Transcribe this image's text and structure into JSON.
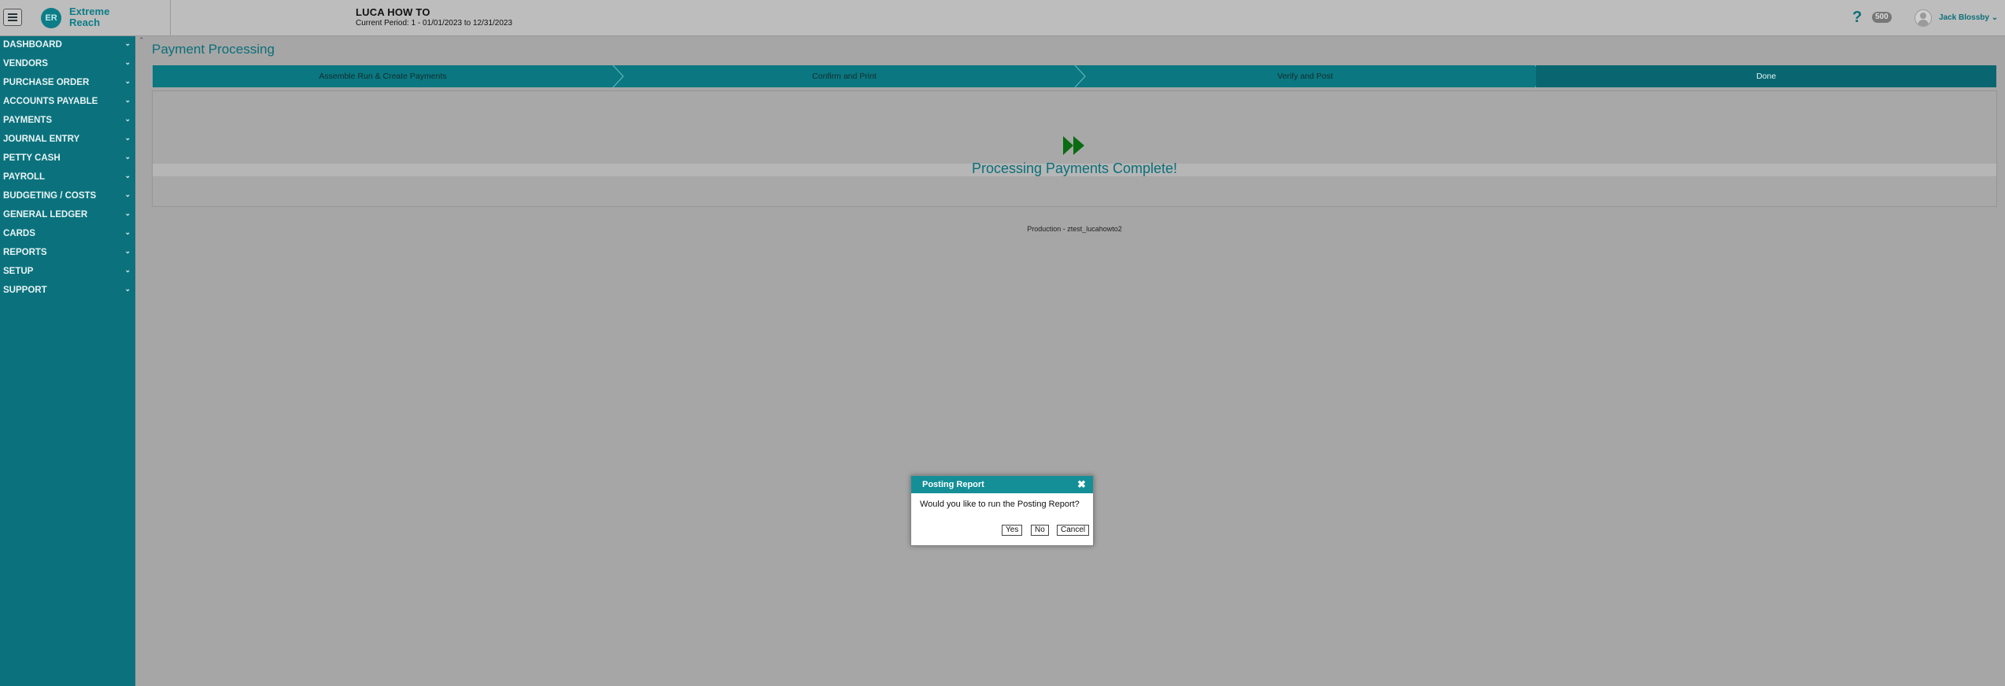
{
  "header": {
    "logo_initials": "ER",
    "logo_line1": "Extreme",
    "logo_line2": "Reach",
    "company": "LUCA HOW TO",
    "period": "Current Period: 1 - 01/01/2023 to 12/31/2023",
    "help_symbol": "?",
    "count_badge": "500",
    "user_name": "Jack Blossby",
    "user_caret": "⌄"
  },
  "sidebar": {
    "items": [
      {
        "label": "DASHBOARD"
      },
      {
        "label": "VENDORS"
      },
      {
        "label": "PURCHASE ORDER"
      },
      {
        "label": "ACCOUNTS PAYABLE"
      },
      {
        "label": "PAYMENTS"
      },
      {
        "label": "JOURNAL ENTRY"
      },
      {
        "label": "PETTY CASH"
      },
      {
        "label": "PAYROLL"
      },
      {
        "label": "BUDGETING / COSTS"
      },
      {
        "label": "GENERAL LEDGER"
      },
      {
        "label": "CARDS"
      },
      {
        "label": "REPORTS"
      },
      {
        "label": "SETUP"
      },
      {
        "label": "SUPPORT"
      }
    ],
    "chevron": "⌄"
  },
  "main": {
    "title": "Payment Processing",
    "steps": [
      {
        "label": "Assemble Run & Create Payments",
        "active": false
      },
      {
        "label": "Confirm and Print",
        "active": false
      },
      {
        "label": "Verify and Post",
        "active": false
      },
      {
        "label": "Done",
        "active": true
      }
    ],
    "complete_message": "Processing Payments Complete!",
    "environment": "Production - ztest_lucahowto2"
  },
  "dialog": {
    "title": "Posting Report",
    "message": "Would you like to run the Posting Report?",
    "yes": "Yes",
    "no": "No",
    "cancel": "Cancel"
  },
  "colors": {
    "teal": "#0b727d",
    "dialog_header": "#148f98",
    "done_icon": "#0a6b12"
  }
}
